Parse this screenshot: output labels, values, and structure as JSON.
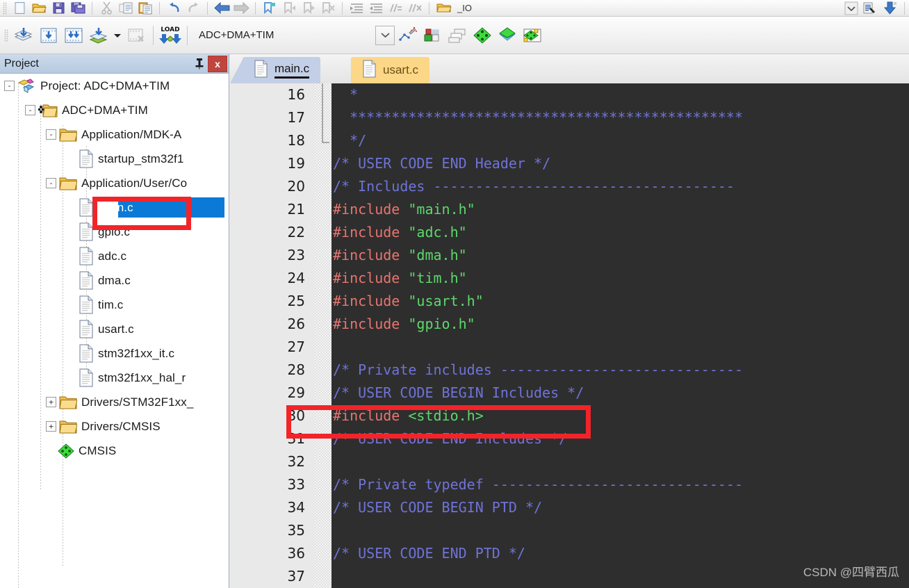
{
  "toolbars": {
    "top": {
      "buttons": [
        {
          "name": "new-file-icon",
          "label": "New"
        },
        {
          "name": "open-file-icon",
          "label": "Open"
        },
        {
          "name": "save-icon",
          "label": "Save"
        },
        {
          "name": "save-all-icon",
          "label": "Save All"
        },
        {
          "name": "cut-icon",
          "label": "Cut"
        },
        {
          "name": "copy-icon",
          "label": "Copy"
        },
        {
          "name": "paste-icon",
          "label": "Paste"
        },
        {
          "name": "undo-icon",
          "label": "Undo"
        },
        {
          "name": "redo-icon",
          "label": "Redo"
        },
        {
          "name": "navigate-back-icon",
          "label": "Back"
        },
        {
          "name": "navigate-forward-icon",
          "label": "Forward"
        },
        {
          "name": "bookmark-toggle-icon",
          "label": "Insert/Remove Bookmark"
        },
        {
          "name": "bookmark-prev-icon",
          "label": "Previous Bookmark"
        },
        {
          "name": "bookmark-next-icon",
          "label": "Next Bookmark"
        },
        {
          "name": "bookmark-clear-icon",
          "label": "Clear All Bookmarks"
        },
        {
          "name": "indent-icon",
          "label": "Indent Selection"
        },
        {
          "name": "outdent-icon",
          "label": "Outdent Selection"
        },
        {
          "name": "comment-icon",
          "label": "Comment Selection"
        },
        {
          "name": "uncomment-icon",
          "label": "Uncomment Selection"
        },
        {
          "name": "find-in-files-icon",
          "label": "Find in Files"
        }
      ],
      "find_value": "_IO",
      "right_buttons": [
        {
          "name": "find-dropdown-icon",
          "label": "Find history"
        },
        {
          "name": "find-options-icon",
          "label": "Find options"
        },
        {
          "name": "insert-icon",
          "label": "Insert"
        }
      ]
    },
    "build": {
      "buttons": [
        {
          "name": "translate-file-icon",
          "label": "Translate current file"
        },
        {
          "name": "build-target-icon",
          "label": "Build"
        },
        {
          "name": "rebuild-all-icon",
          "label": "Rebuild all target files"
        },
        {
          "name": "batch-build-icon",
          "label": "Batch Build"
        },
        {
          "name": "batch-build-dropdown-icon",
          "label": "Batch Build options"
        },
        {
          "name": "stop-build-icon",
          "label": "Stop build"
        },
        {
          "name": "download-icon",
          "label": "LOAD – Download to Flash"
        }
      ],
      "project_select_value": "ADC+DMA+TIM",
      "right_buttons": [
        {
          "name": "target-options-icon",
          "label": "Options for Target"
        },
        {
          "name": "manage-runtime-icon",
          "label": "Manage Run-Time Environment"
        },
        {
          "name": "multi-project-icon",
          "label": "Manage Multi-Project Workspace"
        },
        {
          "name": "pack-installer-icon",
          "label": "Pack Installer"
        },
        {
          "name": "select-software-packs-icon",
          "label": "Select Software Packs"
        },
        {
          "name": "manage-project-items-icon",
          "label": "Manage Project Items"
        }
      ]
    }
  },
  "project_panel": {
    "title": "Project",
    "pin_glyph": "⇳",
    "close_glyph": "x",
    "tree": [
      {
        "label": "Project: ADC+DMA+TIM",
        "icon": "project-icon",
        "indent": 0,
        "expander": "-",
        "selected": false
      },
      {
        "label": "ADC+DMA+TIM",
        "icon": "target-icon",
        "indent": 1,
        "expander": "-",
        "selected": false
      },
      {
        "label": "Application/MDK-A",
        "icon": "folder-icon",
        "indent": 2,
        "expander": "-",
        "selected": false
      },
      {
        "label": "startup_stm32f1",
        "icon": "file-icon",
        "indent": 3,
        "expander": "",
        "selected": false
      },
      {
        "label": "Application/User/Co",
        "icon": "folder-icon",
        "indent": 2,
        "expander": "-",
        "selected": false
      },
      {
        "label": "main.c",
        "icon": "file-icon",
        "indent": 3,
        "expander": "",
        "selected": true
      },
      {
        "label": "gpio.c",
        "icon": "file-icon",
        "indent": 3,
        "expander": "",
        "selected": false
      },
      {
        "label": "adc.c",
        "icon": "file-icon",
        "indent": 3,
        "expander": "",
        "selected": false
      },
      {
        "label": "dma.c",
        "icon": "file-icon",
        "indent": 3,
        "expander": "",
        "selected": false
      },
      {
        "label": "tim.c",
        "icon": "file-icon",
        "indent": 3,
        "expander": "",
        "selected": false
      },
      {
        "label": "usart.c",
        "icon": "file-icon",
        "indent": 3,
        "expander": "",
        "selected": false
      },
      {
        "label": "stm32f1xx_it.c",
        "icon": "file-icon",
        "indent": 3,
        "expander": "",
        "selected": false
      },
      {
        "label": "stm32f1xx_hal_r",
        "icon": "file-icon",
        "indent": 3,
        "expander": "",
        "selected": false
      },
      {
        "label": "Drivers/STM32F1xx_",
        "icon": "folder-icon",
        "indent": 2,
        "expander": "+",
        "selected": false
      },
      {
        "label": "Drivers/CMSIS",
        "icon": "folder-icon",
        "indent": 2,
        "expander": "+",
        "selected": false
      },
      {
        "label": "CMSIS",
        "icon": "cmsis-icon",
        "indent": 2,
        "expander": "",
        "selected": false
      }
    ]
  },
  "editor": {
    "tabs": [
      {
        "label": "main.c",
        "active": true,
        "icon": "file-icon"
      },
      {
        "label": "usart.c",
        "active": false,
        "icon": "file-icon"
      }
    ],
    "first_line": 16,
    "lines": [
      {
        "n": "16",
        "tokens": [
          {
            "t": "  *",
            "c": "cmt"
          }
        ]
      },
      {
        "n": "17",
        "tokens": [
          {
            "t": "  ***********************************************",
            "c": "cmt"
          }
        ]
      },
      {
        "n": "18",
        "tokens": [
          {
            "t": "  */",
            "c": "cmt"
          }
        ]
      },
      {
        "n": "19",
        "tokens": [
          {
            "t": "/* USER CODE END Header */",
            "c": "cmt"
          }
        ]
      },
      {
        "n": "20",
        "tokens": [
          {
            "t": "/* Includes ------------------------------------",
            "c": "cmt"
          }
        ]
      },
      {
        "n": "21",
        "tokens": [
          {
            "t": "#include ",
            "c": "pp"
          },
          {
            "t": "\"main.h\"",
            "c": "str"
          }
        ]
      },
      {
        "n": "22",
        "tokens": [
          {
            "t": "#include ",
            "c": "pp"
          },
          {
            "t": "\"adc.h\"",
            "c": "str"
          }
        ]
      },
      {
        "n": "23",
        "tokens": [
          {
            "t": "#include ",
            "c": "pp"
          },
          {
            "t": "\"dma.h\"",
            "c": "str"
          }
        ]
      },
      {
        "n": "24",
        "tokens": [
          {
            "t": "#include ",
            "c": "pp"
          },
          {
            "t": "\"tim.h\"",
            "c": "str"
          }
        ]
      },
      {
        "n": "25",
        "tokens": [
          {
            "t": "#include ",
            "c": "pp"
          },
          {
            "t": "\"usart.h\"",
            "c": "str"
          }
        ]
      },
      {
        "n": "26",
        "tokens": [
          {
            "t": "#include ",
            "c": "pp"
          },
          {
            "t": "\"gpio.h\"",
            "c": "str"
          }
        ]
      },
      {
        "n": "27",
        "tokens": []
      },
      {
        "n": "28",
        "tokens": [
          {
            "t": "/* Private includes -----------------------------",
            "c": "cmt"
          }
        ]
      },
      {
        "n": "29",
        "tokens": [
          {
            "t": "/* USER CODE BEGIN Includes */",
            "c": "cmt"
          }
        ]
      },
      {
        "n": "30",
        "tokens": [
          {
            "t": "#include ",
            "c": "pp"
          },
          {
            "t": "<stdio.h>",
            "c": "str"
          }
        ]
      },
      {
        "n": "31",
        "tokens": [
          {
            "t": "/* USER CODE END Includes */",
            "c": "cmt"
          }
        ]
      },
      {
        "n": "32",
        "tokens": []
      },
      {
        "n": "33",
        "tokens": [
          {
            "t": "/* Private typedef ------------------------------",
            "c": "cmt"
          }
        ]
      },
      {
        "n": "34",
        "tokens": [
          {
            "t": "/* USER CODE BEGIN PTD */",
            "c": "cmt"
          }
        ]
      },
      {
        "n": "35",
        "tokens": []
      },
      {
        "n": "36",
        "tokens": [
          {
            "t": "/* USER CODE END PTD */",
            "c": "cmt"
          }
        ]
      },
      {
        "n": "37",
        "tokens": []
      }
    ]
  },
  "annotations": [
    {
      "name": "annotation-main-c",
      "target": "main.c tree item"
    },
    {
      "name": "annotation-line-30",
      "target": "#include <stdio.h>"
    }
  ],
  "watermark": "CSDN @四臂西瓜",
  "colors": {
    "selection_blue": "#0b7ad6",
    "annotation_red": "#f2242a",
    "code_bg": "#2e2e2e",
    "comment": "#6f73d8",
    "preprocessor": "#e8756f",
    "string": "#5cd96a",
    "gutter_bg": "#e9e9e9",
    "panel_title_bg": "#c0d2e6",
    "tab_active_bg": "#c3cfe6",
    "tab_inactive_bg": "#fcd787"
  }
}
